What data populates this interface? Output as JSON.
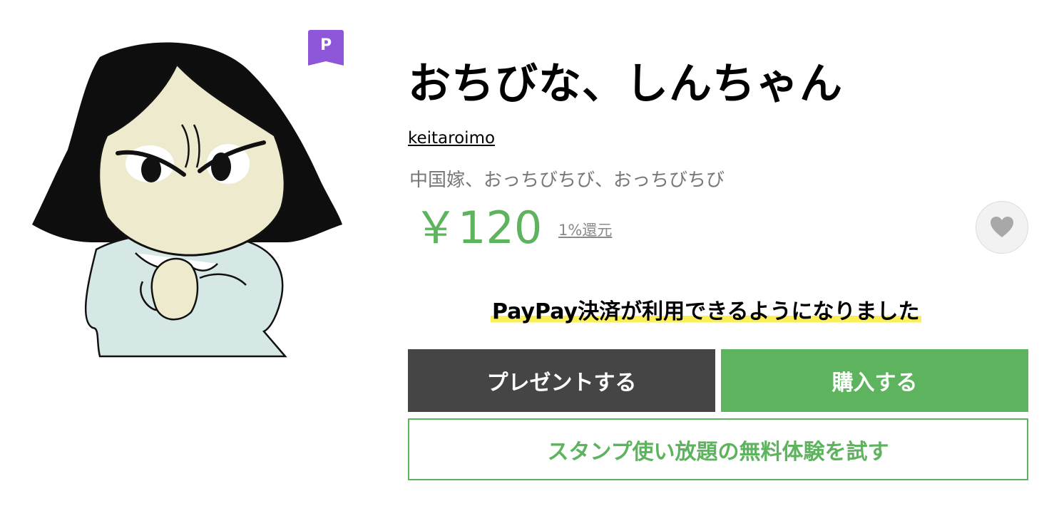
{
  "sticker": {
    "badge_label": "P",
    "icon": "premium-badge-icon"
  },
  "product": {
    "title": "おちびな、しんちゃん",
    "author": "keitaroimo",
    "description": "中国嫁、おっちびちび、おっちびちび",
    "price": "￥120",
    "return_label": "1%還元"
  },
  "favorite": {
    "icon": "heart-icon"
  },
  "notice": {
    "text": "PayPay決済が利用できるようになりました"
  },
  "actions": {
    "present_label": "プレゼントする",
    "buy_label": "購入する",
    "trial_label": "スタンプ使い放題の無料体験を試す"
  },
  "colors": {
    "accent_green": "#5eb35e",
    "dark_button": "#454545",
    "badge_purple": "#8e56d8",
    "highlight_yellow": "#fbef58"
  }
}
